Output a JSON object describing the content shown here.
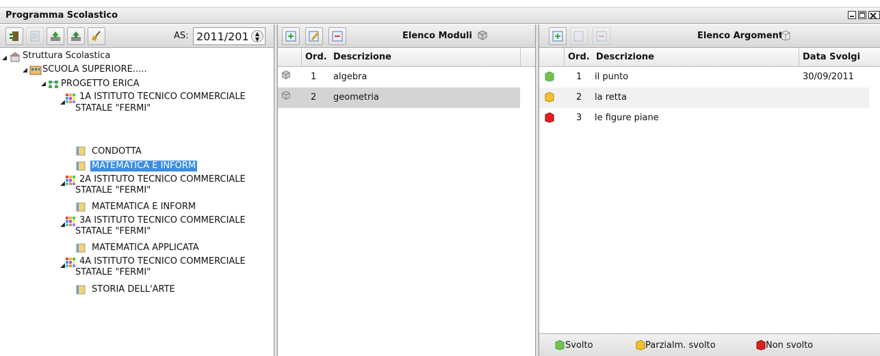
{
  "window": {
    "title": "Programma Scolastico"
  },
  "left": {
    "as_label": "AS:",
    "as_value": "2011/201",
    "tree": {
      "root": "Struttura Scolastica",
      "school": "SCUOLA SUPERIORE.....",
      "project": "PROGETTO ERICA",
      "classes": [
        {
          "line1": "1A ISTITUTO TECNICO COMMERCIALE",
          "line2": "STATALE \"FERMI\"",
          "subjects": [
            "CONDOTTA",
            "MATEMATICA E INFORM"
          ]
        },
        {
          "line1": "2A ISTITUTO TECNICO COMMERCIALE",
          "line2": "STATALE \"FERMI\"",
          "subjects": [
            "MATEMATICA E INFORM"
          ]
        },
        {
          "line1": "3A ISTITUTO TECNICO COMMERCIALE",
          "line2": "STATALE \"FERMI\"",
          "subjects": [
            "MATEMATICA APPLICATA"
          ]
        },
        {
          "line1": "4A ISTITUTO TECNICO COMMERCIALE",
          "line2": "STATALE \"FERMI\"",
          "subjects": [
            "STORIA DELL'ARTE"
          ]
        }
      ],
      "selected": "MATEMATICA E INFORM"
    }
  },
  "moduli": {
    "title": "Elenco Moduli",
    "col_ord": "Ord.",
    "col_desc": "Descrizione",
    "rows": [
      {
        "ord": "1",
        "desc": "algebra"
      },
      {
        "ord": "2",
        "desc": "geometria"
      }
    ]
  },
  "argomenti": {
    "title": "Elenco Argomenti",
    "col_ord": "Ord.",
    "col_desc": "Descrizione",
    "col_date": "Data Svolgi",
    "rows": [
      {
        "ord": "1",
        "desc": "il punto",
        "date": "30/09/2011",
        "status": "green"
      },
      {
        "ord": "2",
        "desc": "la retta",
        "date": "",
        "status": "yellow"
      },
      {
        "ord": "3",
        "desc": "le figure piane",
        "date": "",
        "status": "red"
      }
    ]
  },
  "legend": {
    "done": "Svolto",
    "partial": "Parzialm. svolto",
    "not_done": "Non svolto"
  },
  "colors": {
    "selection": "#3d8ee0",
    "done": "#7bc043",
    "partial": "#f2c12e",
    "not_done": "#e02020"
  }
}
